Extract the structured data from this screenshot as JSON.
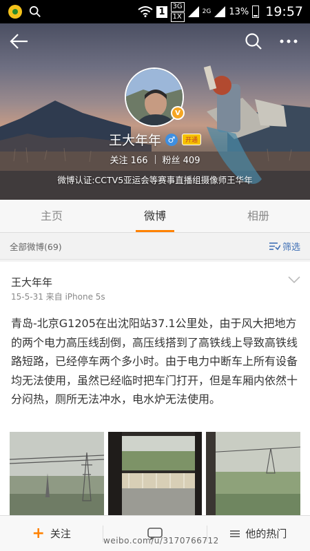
{
  "status_bar": {
    "sim_slot": "1",
    "network_top": "3G",
    "network_bottom": "1X",
    "network_2g": "2G",
    "battery_percent": "13%",
    "time": "19:57"
  },
  "header": {
    "back_icon": "arrow-left-icon",
    "search_icon": "search-icon",
    "more_icon": "more-dots-icon"
  },
  "profile": {
    "name": "王大年年",
    "gender_icon": "male-icon",
    "vip_label": "开通",
    "following_label": "关注",
    "following_count": "166",
    "followers_label": "粉丝",
    "followers_count": "409",
    "verification": "微博认证:CCTV5亚运会等赛事直播组摄像师王华年"
  },
  "tabs": [
    {
      "label": "主页",
      "active": false
    },
    {
      "label": "微博",
      "active": true
    },
    {
      "label": "相册",
      "active": false
    }
  ],
  "filter": {
    "label": "全部微博(69)",
    "button": "筛选"
  },
  "post": {
    "author": "王大年年",
    "meta": "15-5-31  来自 iPhone 5s",
    "text": "青岛-北京G1205在出沈阳站37.1公里处，由于风大把地方的两个电力高压线刮倒，高压线搭到了高铁线上导致高铁线路短路，已经停车两个多小时。由于电力中断车上所有设备均无法使用，虽然已经临时把车门打开，但是车厢内依然十分闷热，厕所无法冲水，电水炉无法使用。"
  },
  "bottom_bar": {
    "follow_label": "关注",
    "hot_label": "他的热门"
  },
  "watermark": "weibo.com/u/3170766712",
  "colors": {
    "accent": "#ff8200",
    "link": "#3f6fb5"
  }
}
